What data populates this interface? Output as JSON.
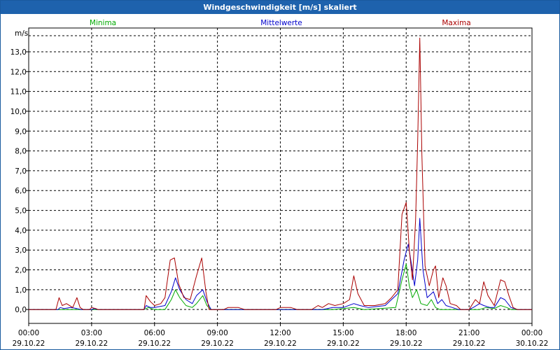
{
  "window": {
    "title": "Windgeschwindigkeit [m/s] skaliert"
  },
  "chart_data": {
    "type": "line",
    "title": "Windgeschwindigkeit [m/s] skaliert",
    "ylabel": "m/s",
    "xlabel": "",
    "ylim": [
      -0.7,
      14.2
    ],
    "xlim": [
      0,
      24
    ],
    "grid": true,
    "legend_placement": "top",
    "yticks": [
      0,
      1,
      2,
      3,
      4,
      5,
      6,
      7,
      8,
      9,
      10,
      11,
      12,
      13
    ],
    "ytick_labels": [
      "0,0",
      "1,0",
      "2,0",
      "3,0",
      "4,0",
      "5,0",
      "6,0",
      "7,0",
      "8,0",
      "9,0",
      "10,0",
      "11,0",
      "12,0",
      "13,0"
    ],
    "xticks": [
      {
        "time": "00:00",
        "date": "29.10.22"
      },
      {
        "time": "03:00",
        "date": "29.10.22"
      },
      {
        "time": "06:00",
        "date": "29.10.22"
      },
      {
        "time": "09:00",
        "date": "29.10.22"
      },
      {
        "time": "12:00",
        "date": "29.10.22"
      },
      {
        "time": "15:00",
        "date": "29.10.22"
      },
      {
        "time": "18:00",
        "date": "29.10.22"
      },
      {
        "time": "21:00",
        "date": "29.10.22"
      },
      {
        "time": "00:00",
        "date": "30.10.22"
      }
    ],
    "series": [
      {
        "name": "Minima",
        "color": "#00aa00",
        "points": [
          [
            0,
            0
          ],
          [
            5.5,
            0
          ],
          [
            5.7,
            0.1
          ],
          [
            6.0,
            0
          ],
          [
            6.5,
            0
          ],
          [
            6.8,
            0.5
          ],
          [
            7.0,
            1.0
          ],
          [
            7.2,
            0.6
          ],
          [
            7.5,
            0.2
          ],
          [
            7.8,
            0.1
          ],
          [
            8.0,
            0.3
          ],
          [
            8.3,
            0.7
          ],
          [
            8.5,
            0.2
          ],
          [
            8.7,
            0
          ],
          [
            14.5,
            0
          ],
          [
            15.5,
            0.1
          ],
          [
            16,
            0
          ],
          [
            17.5,
            0.1
          ],
          [
            17.8,
            1.5
          ],
          [
            18.0,
            2.3
          ],
          [
            18.15,
            1.2
          ],
          [
            18.3,
            0.6
          ],
          [
            18.5,
            1.0
          ],
          [
            18.7,
            0.3
          ],
          [
            19.0,
            0.2
          ],
          [
            19.2,
            0.5
          ],
          [
            19.4,
            0.1
          ],
          [
            19.6,
            0
          ],
          [
            21.5,
            0
          ],
          [
            21.8,
            0.1
          ],
          [
            22.2,
            0.05
          ],
          [
            22.5,
            0.2
          ],
          [
            22.8,
            0.1
          ],
          [
            23.0,
            0
          ],
          [
            24,
            0
          ]
        ]
      },
      {
        "name": "Mittelwerte",
        "color": "#0000cc",
        "points": [
          [
            0,
            0
          ],
          [
            1.4,
            0
          ],
          [
            1.5,
            0.1
          ],
          [
            1.7,
            0.05
          ],
          [
            2.0,
            0.1
          ],
          [
            2.3,
            0.05
          ],
          [
            2.5,
            0
          ],
          [
            3.0,
            0
          ],
          [
            3.1,
            0.05
          ],
          [
            3.3,
            0
          ],
          [
            5.5,
            0
          ],
          [
            5.6,
            0.2
          ],
          [
            5.8,
            0.1
          ],
          [
            6.0,
            0.1
          ],
          [
            6.5,
            0.2
          ],
          [
            6.8,
            0.9
          ],
          [
            7.0,
            1.6
          ],
          [
            7.2,
            1.0
          ],
          [
            7.5,
            0.5
          ],
          [
            7.8,
            0.3
          ],
          [
            8.0,
            0.7
          ],
          [
            8.3,
            1.0
          ],
          [
            8.5,
            0.4
          ],
          [
            8.7,
            0
          ],
          [
            14.0,
            0
          ],
          [
            14.5,
            0.1
          ],
          [
            15.0,
            0.1
          ],
          [
            15.5,
            0.3
          ],
          [
            15.8,
            0.2
          ],
          [
            16.2,
            0.1
          ],
          [
            17.0,
            0.2
          ],
          [
            17.6,
            0.8
          ],
          [
            17.9,
            2.5
          ],
          [
            18.1,
            3.3
          ],
          [
            18.25,
            2.3
          ],
          [
            18.4,
            1.2
          ],
          [
            18.55,
            2.5
          ],
          [
            18.65,
            4.6
          ],
          [
            18.8,
            2.0
          ],
          [
            19.0,
            0.6
          ],
          [
            19.3,
            0.9
          ],
          [
            19.5,
            0.3
          ],
          [
            19.7,
            0.5
          ],
          [
            19.9,
            0.2
          ],
          [
            20.2,
            0.1
          ],
          [
            20.5,
            0
          ],
          [
            21.0,
            0
          ],
          [
            21.2,
            0.1
          ],
          [
            21.5,
            0.3
          ],
          [
            21.7,
            0.2
          ],
          [
            22.0,
            0.1
          ],
          [
            22.2,
            0.1
          ],
          [
            22.5,
            0.6
          ],
          [
            22.7,
            0.5
          ],
          [
            23.0,
            0.1
          ],
          [
            23.3,
            0
          ],
          [
            24,
            0
          ]
        ]
      },
      {
        "name": "Maxima",
        "color": "#aa0000",
        "points": [
          [
            0,
            0
          ],
          [
            1.3,
            0
          ],
          [
            1.45,
            0.6
          ],
          [
            1.6,
            0.2
          ],
          [
            1.8,
            0.3
          ],
          [
            2.1,
            0.1
          ],
          [
            2.3,
            0.6
          ],
          [
            2.45,
            0.1
          ],
          [
            2.6,
            0
          ],
          [
            2.9,
            0
          ],
          [
            3.0,
            0.1
          ],
          [
            3.2,
            0.05
          ],
          [
            3.3,
            0
          ],
          [
            5.5,
            0
          ],
          [
            5.6,
            0.7
          ],
          [
            5.8,
            0.4
          ],
          [
            6.0,
            0.2
          ],
          [
            6.3,
            0.3
          ],
          [
            6.5,
            0.6
          ],
          [
            6.75,
            2.5
          ],
          [
            6.95,
            2.6
          ],
          [
            7.15,
            1.3
          ],
          [
            7.4,
            0.6
          ],
          [
            7.7,
            0.5
          ],
          [
            8.0,
            1.7
          ],
          [
            8.25,
            2.6
          ],
          [
            8.45,
            0.9
          ],
          [
            8.6,
            0
          ],
          [
            9.3,
            0
          ],
          [
            9.5,
            0.1
          ],
          [
            10.0,
            0.1
          ],
          [
            10.3,
            0
          ],
          [
            11.8,
            0
          ],
          [
            12.0,
            0.1
          ],
          [
            12.5,
            0.1
          ],
          [
            12.8,
            0
          ],
          [
            13.5,
            0
          ],
          [
            13.8,
            0.2
          ],
          [
            14.0,
            0.1
          ],
          [
            14.3,
            0.3
          ],
          [
            14.6,
            0.2
          ],
          [
            15.0,
            0.3
          ],
          [
            15.3,
            0.5
          ],
          [
            15.5,
            1.7
          ],
          [
            15.7,
            0.8
          ],
          [
            16.0,
            0.2
          ],
          [
            16.5,
            0.2
          ],
          [
            17.0,
            0.3
          ],
          [
            17.3,
            0.6
          ],
          [
            17.6,
            1.0
          ],
          [
            17.8,
            4.8
          ],
          [
            18.0,
            5.4
          ],
          [
            18.15,
            3.0
          ],
          [
            18.3,
            1.5
          ],
          [
            18.45,
            4.5
          ],
          [
            18.55,
            8.5
          ],
          [
            18.65,
            13.7
          ],
          [
            18.75,
            7.8
          ],
          [
            18.9,
            2.2
          ],
          [
            19.1,
            1.2
          ],
          [
            19.3,
            2.0
          ],
          [
            19.4,
            2.2
          ],
          [
            19.55,
            0.6
          ],
          [
            19.75,
            1.6
          ],
          [
            19.9,
            1.2
          ],
          [
            20.1,
            0.3
          ],
          [
            20.4,
            0.2
          ],
          [
            20.6,
            0
          ],
          [
            21.0,
            0
          ],
          [
            21.3,
            0.5
          ],
          [
            21.5,
            0.3
          ],
          [
            21.7,
            1.4
          ],
          [
            21.9,
            0.7
          ],
          [
            22.2,
            0.2
          ],
          [
            22.5,
            1.5
          ],
          [
            22.7,
            1.4
          ],
          [
            22.9,
            0.7
          ],
          [
            23.1,
            0.1
          ],
          [
            23.3,
            0
          ],
          [
            24,
            0
          ]
        ]
      }
    ]
  }
}
